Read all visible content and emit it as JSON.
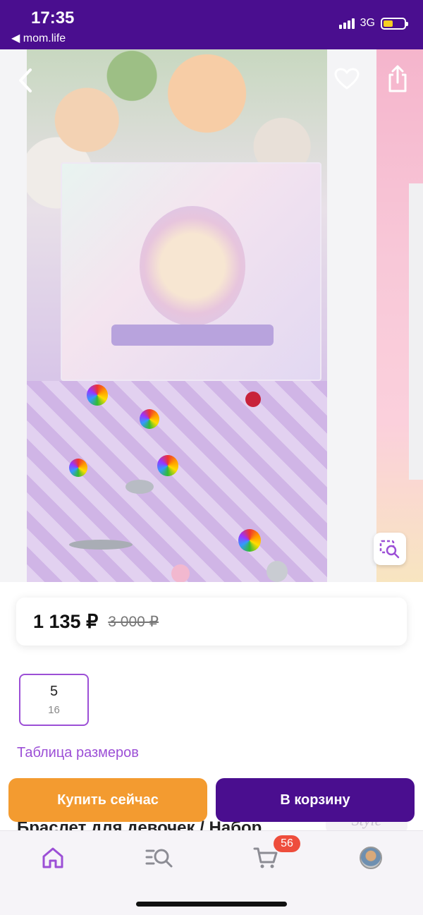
{
  "status_bar": {
    "time": "17:35",
    "back_app": "◀ mom.life",
    "network": "3G"
  },
  "gallery": {
    "icons": [
      "back-icon",
      "heart-icon",
      "share-icon",
      "image-search-icon"
    ]
  },
  "price": {
    "current": "1 135 ₽",
    "old": "3 000 ₽"
  },
  "size": {
    "main": "5",
    "sub": "16"
  },
  "size_table_link": "Таблица размеров",
  "actions": {
    "buy_now": "Купить сейчас",
    "add_to_cart": "В корзину"
  },
  "product": {
    "title": "Браслет для девочек / Набор",
    "brand": "Style"
  },
  "tab_bar": {
    "icons": [
      "home-icon",
      "catalog-search-icon",
      "cart-icon",
      "avatar"
    ],
    "cart_count": "56"
  },
  "colors": {
    "brand_purple": "#4a0e8f",
    "accent_orange": "#f39b30",
    "accent_violet": "#9c4fd6",
    "badge_red": "#ee4d3c"
  }
}
